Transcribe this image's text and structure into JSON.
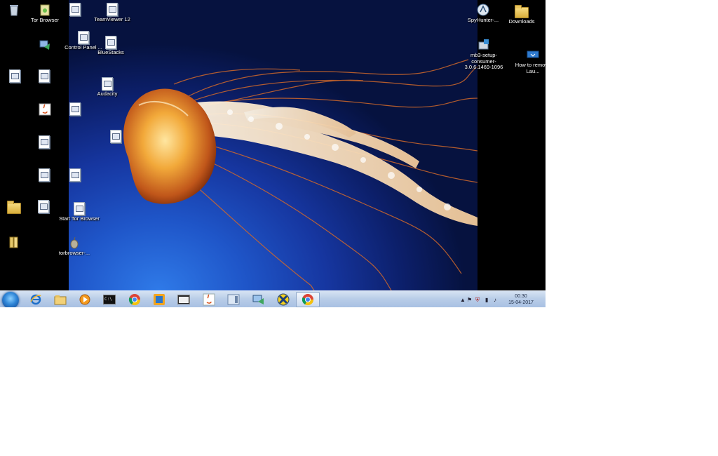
{
  "desktop": {
    "icons": [
      {
        "label": "",
        "icon": "recycle-bin-icon"
      },
      {
        "label": "Tor Browser",
        "icon": "tor-folder-icon"
      },
      {
        "label": "",
        "icon": "shortcut-icon"
      },
      {
        "label": "TeamViewer 12",
        "icon": "teamviewer-icon"
      },
      {
        "label": "Control Panel ...",
        "icon": "control-panel-icon"
      },
      {
        "label": "BlueStacks",
        "icon": "bluestacks-icon"
      },
      {
        "label": "",
        "icon": "network-icon"
      },
      {
        "label": "",
        "icon": "file-icon"
      },
      {
        "label": "",
        "icon": "file-icon"
      },
      {
        "label": "Audacity",
        "icon": "audacity-icon"
      },
      {
        "label": "",
        "icon": "java-icon"
      },
      {
        "label": "",
        "icon": "file-icon"
      },
      {
        "label": "",
        "icon": "file-icon"
      },
      {
        "label": "",
        "icon": "file-icon"
      },
      {
        "label": "",
        "icon": "file-icon"
      },
      {
        "label": "",
        "icon": "file-icon"
      },
      {
        "label": "",
        "icon": "folder-doc-icon"
      },
      {
        "label": "",
        "icon": "file-icon"
      },
      {
        "label": "Start Tor Browser",
        "icon": "start-tor-browser-icon"
      },
      {
        "label": "",
        "icon": "books-icon"
      },
      {
        "label": "torbrowser-...",
        "icon": "torbrowser-onion-icon"
      },
      {
        "label": "SpyHunter-...",
        "icon": "spyhunter-icon"
      },
      {
        "label": "Downloads",
        "icon": "downloads-folder-icon"
      },
      {
        "label": "mb3-setup-consumer-3.0.6.1469-1096",
        "icon": "installer-icon"
      },
      {
        "label": "How to remove Lau...",
        "icon": "link-file-icon"
      }
    ]
  },
  "taskbar": {
    "pinned": [
      {
        "name": "internet-explorer-icon"
      },
      {
        "name": "file-explorer-icon"
      },
      {
        "name": "media-player-icon"
      },
      {
        "name": "command-prompt-icon"
      },
      {
        "name": "chrome-icon"
      },
      {
        "name": "windows-app-icon"
      },
      {
        "name": "blank-window-icon"
      },
      {
        "name": "java-icon"
      },
      {
        "name": "document-window-icon"
      },
      {
        "name": "network-app-icon"
      },
      {
        "name": "xming-icon"
      },
      {
        "name": "chrome-icon",
        "active": true
      }
    ],
    "clock": {
      "time": "00:30",
      "date": "15-04-2017"
    }
  }
}
